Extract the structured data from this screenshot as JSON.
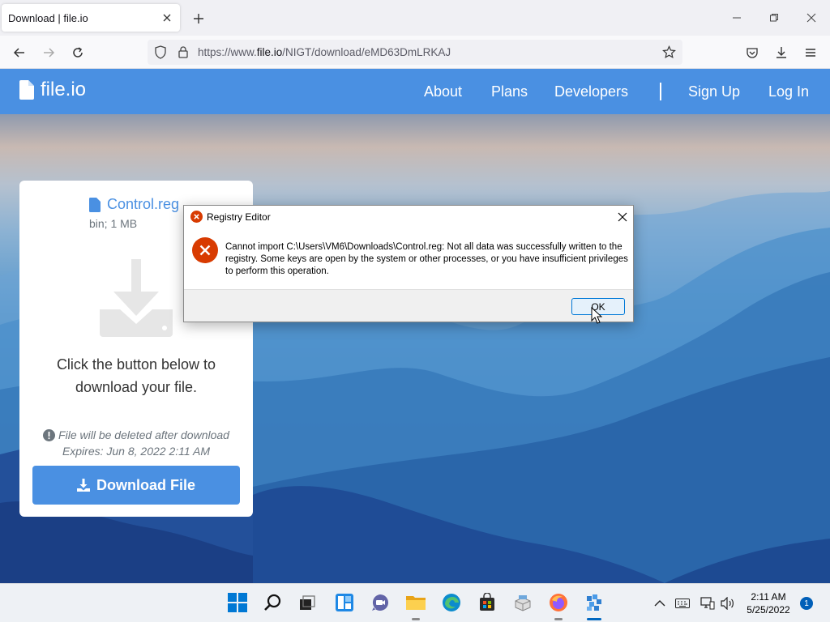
{
  "browser": {
    "tab_title": "Download | file.io",
    "url_prefix": "https://www.",
    "url_domain": "file.io",
    "url_path": "/NIGT/download/eMD63DmLRKAJ"
  },
  "site": {
    "logo_text": "file.io",
    "nav": {
      "about": "About",
      "plans": "Plans",
      "developers": "Developers",
      "sign_up": "Sign Up",
      "log_in": "Log In"
    },
    "brand_color": "#4a90e2"
  },
  "card": {
    "file_name": "Control.reg",
    "file_meta": "bin; 1 MB",
    "instruction_line1": "Click the button below to",
    "instruction_line2": "download your file.",
    "delete_note": "File will be deleted after download",
    "expires": "Expires: Jun 8, 2022 2:11 AM",
    "download_label": "Download File"
  },
  "dialog": {
    "title": "Registry Editor",
    "message": "Cannot import C:\\Users\\VM6\\Downloads\\Control.reg: Not all data was successfully written to the registry.  Some keys are open by the system or other processes, or you have insufficient privileges to perform this operation.",
    "ok_label": "OK",
    "error_color": "#d83b01"
  },
  "taskbar": {
    "apps": [
      "windows-start-icon",
      "search-icon",
      "task-view-icon",
      "widgets-icon",
      "chat-icon",
      "file-explorer-icon",
      "edge-icon",
      "store-icon",
      "app-icon",
      "firefox-icon",
      "registry-editor-icon"
    ],
    "time": "2:11 AM",
    "date": "5/25/2022",
    "notification_count": "1"
  }
}
